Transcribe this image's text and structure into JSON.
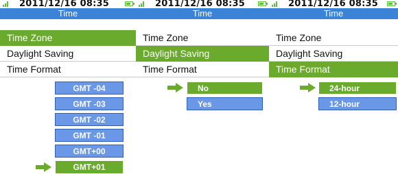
{
  "status": {
    "datetime": "2011/12/16 08:35"
  },
  "screens": [
    {
      "title": "Time",
      "menu": [
        "Time Zone",
        "Daylight Saving",
        "Time Format"
      ],
      "selected_menu": 0,
      "options": [
        "GMT -04",
        "GMT -03",
        "GMT -02",
        "GMT -01",
        "GMT+00",
        "GMT+01"
      ],
      "selected_option": 5
    },
    {
      "title": "Time",
      "menu": [
        "Time Zone",
        "Daylight Saving",
        "Time Format"
      ],
      "selected_menu": 1,
      "options": [
        "No",
        "Yes"
      ],
      "selected_option": 0
    },
    {
      "title": "Time",
      "menu": [
        "Time Zone",
        "Daylight Saving",
        "Time Format"
      ],
      "selected_menu": 2,
      "options": [
        "24-hour",
        "12-hour"
      ],
      "selected_option": 0
    }
  ],
  "colors": {
    "title_bar": "#3b83d6",
    "highlight": "#6aaa2c",
    "option_bg": "#6a97e6",
    "arrow": "#6aaa2c"
  },
  "icons": [
    "signal-icon",
    "battery-icon",
    "arrow-right-icon"
  ]
}
